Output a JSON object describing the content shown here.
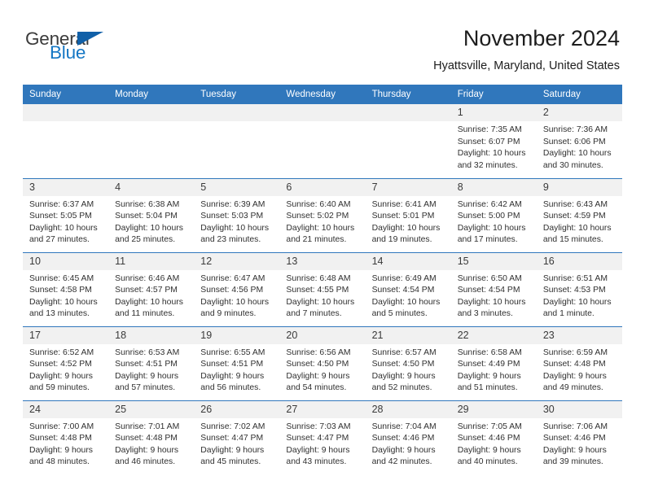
{
  "brand": {
    "name_part1": "General",
    "name_part2": "Blue",
    "triangle_color": "#1060a8",
    "blue_color": "#1577c4",
    "gray_color": "#3b3b3b"
  },
  "header": {
    "title": "November 2024",
    "subtitle": "Hyattsville, Maryland, United States"
  },
  "theme": {
    "header_blue": "#3077bc",
    "daynum_band": "#f1f1f1",
    "row_separator": "#3077bc",
    "text": "#303030"
  },
  "calendar": {
    "weekday_headers": [
      "Sunday",
      "Monday",
      "Tuesday",
      "Wednesday",
      "Thursday",
      "Friday",
      "Saturday"
    ],
    "weeks": [
      [
        {
          "day": "",
          "empty": true
        },
        {
          "day": "",
          "empty": true
        },
        {
          "day": "",
          "empty": true
        },
        {
          "day": "",
          "empty": true
        },
        {
          "day": "",
          "empty": true
        },
        {
          "day": "1",
          "sunrise": "Sunrise: 7:35 AM",
          "sunset": "Sunset: 6:07 PM",
          "daylight": "Daylight: 10 hours and 32 minutes."
        },
        {
          "day": "2",
          "sunrise": "Sunrise: 7:36 AM",
          "sunset": "Sunset: 6:06 PM",
          "daylight": "Daylight: 10 hours and 30 minutes."
        }
      ],
      [
        {
          "day": "3",
          "sunrise": "Sunrise: 6:37 AM",
          "sunset": "Sunset: 5:05 PM",
          "daylight": "Daylight: 10 hours and 27 minutes."
        },
        {
          "day": "4",
          "sunrise": "Sunrise: 6:38 AM",
          "sunset": "Sunset: 5:04 PM",
          "daylight": "Daylight: 10 hours and 25 minutes."
        },
        {
          "day": "5",
          "sunrise": "Sunrise: 6:39 AM",
          "sunset": "Sunset: 5:03 PM",
          "daylight": "Daylight: 10 hours and 23 minutes."
        },
        {
          "day": "6",
          "sunrise": "Sunrise: 6:40 AM",
          "sunset": "Sunset: 5:02 PM",
          "daylight": "Daylight: 10 hours and 21 minutes."
        },
        {
          "day": "7",
          "sunrise": "Sunrise: 6:41 AM",
          "sunset": "Sunset: 5:01 PM",
          "daylight": "Daylight: 10 hours and 19 minutes."
        },
        {
          "day": "8",
          "sunrise": "Sunrise: 6:42 AM",
          "sunset": "Sunset: 5:00 PM",
          "daylight": "Daylight: 10 hours and 17 minutes."
        },
        {
          "day": "9",
          "sunrise": "Sunrise: 6:43 AM",
          "sunset": "Sunset: 4:59 PM",
          "daylight": "Daylight: 10 hours and 15 minutes."
        }
      ],
      [
        {
          "day": "10",
          "sunrise": "Sunrise: 6:45 AM",
          "sunset": "Sunset: 4:58 PM",
          "daylight": "Daylight: 10 hours and 13 minutes."
        },
        {
          "day": "11",
          "sunrise": "Sunrise: 6:46 AM",
          "sunset": "Sunset: 4:57 PM",
          "daylight": "Daylight: 10 hours and 11 minutes."
        },
        {
          "day": "12",
          "sunrise": "Sunrise: 6:47 AM",
          "sunset": "Sunset: 4:56 PM",
          "daylight": "Daylight: 10 hours and 9 minutes."
        },
        {
          "day": "13",
          "sunrise": "Sunrise: 6:48 AM",
          "sunset": "Sunset: 4:55 PM",
          "daylight": "Daylight: 10 hours and 7 minutes."
        },
        {
          "day": "14",
          "sunrise": "Sunrise: 6:49 AM",
          "sunset": "Sunset: 4:54 PM",
          "daylight": "Daylight: 10 hours and 5 minutes."
        },
        {
          "day": "15",
          "sunrise": "Sunrise: 6:50 AM",
          "sunset": "Sunset: 4:54 PM",
          "daylight": "Daylight: 10 hours and 3 minutes."
        },
        {
          "day": "16",
          "sunrise": "Sunrise: 6:51 AM",
          "sunset": "Sunset: 4:53 PM",
          "daylight": "Daylight: 10 hours and 1 minute."
        }
      ],
      [
        {
          "day": "17",
          "sunrise": "Sunrise: 6:52 AM",
          "sunset": "Sunset: 4:52 PM",
          "daylight": "Daylight: 9 hours and 59 minutes."
        },
        {
          "day": "18",
          "sunrise": "Sunrise: 6:53 AM",
          "sunset": "Sunset: 4:51 PM",
          "daylight": "Daylight: 9 hours and 57 minutes."
        },
        {
          "day": "19",
          "sunrise": "Sunrise: 6:55 AM",
          "sunset": "Sunset: 4:51 PM",
          "daylight": "Daylight: 9 hours and 56 minutes."
        },
        {
          "day": "20",
          "sunrise": "Sunrise: 6:56 AM",
          "sunset": "Sunset: 4:50 PM",
          "daylight": "Daylight: 9 hours and 54 minutes."
        },
        {
          "day": "21",
          "sunrise": "Sunrise: 6:57 AM",
          "sunset": "Sunset: 4:50 PM",
          "daylight": "Daylight: 9 hours and 52 minutes."
        },
        {
          "day": "22",
          "sunrise": "Sunrise: 6:58 AM",
          "sunset": "Sunset: 4:49 PM",
          "daylight": "Daylight: 9 hours and 51 minutes."
        },
        {
          "day": "23",
          "sunrise": "Sunrise: 6:59 AM",
          "sunset": "Sunset: 4:48 PM",
          "daylight": "Daylight: 9 hours and 49 minutes."
        }
      ],
      [
        {
          "day": "24",
          "sunrise": "Sunrise: 7:00 AM",
          "sunset": "Sunset: 4:48 PM",
          "daylight": "Daylight: 9 hours and 48 minutes."
        },
        {
          "day": "25",
          "sunrise": "Sunrise: 7:01 AM",
          "sunset": "Sunset: 4:48 PM",
          "daylight": "Daylight: 9 hours and 46 minutes."
        },
        {
          "day": "26",
          "sunrise": "Sunrise: 7:02 AM",
          "sunset": "Sunset: 4:47 PM",
          "daylight": "Daylight: 9 hours and 45 minutes."
        },
        {
          "day": "27",
          "sunrise": "Sunrise: 7:03 AM",
          "sunset": "Sunset: 4:47 PM",
          "daylight": "Daylight: 9 hours and 43 minutes."
        },
        {
          "day": "28",
          "sunrise": "Sunrise: 7:04 AM",
          "sunset": "Sunset: 4:46 PM",
          "daylight": "Daylight: 9 hours and 42 minutes."
        },
        {
          "day": "29",
          "sunrise": "Sunrise: 7:05 AM",
          "sunset": "Sunset: 4:46 PM",
          "daylight": "Daylight: 9 hours and 40 minutes."
        },
        {
          "day": "30",
          "sunrise": "Sunrise: 7:06 AM",
          "sunset": "Sunset: 4:46 PM",
          "daylight": "Daylight: 9 hours and 39 minutes."
        }
      ]
    ]
  }
}
